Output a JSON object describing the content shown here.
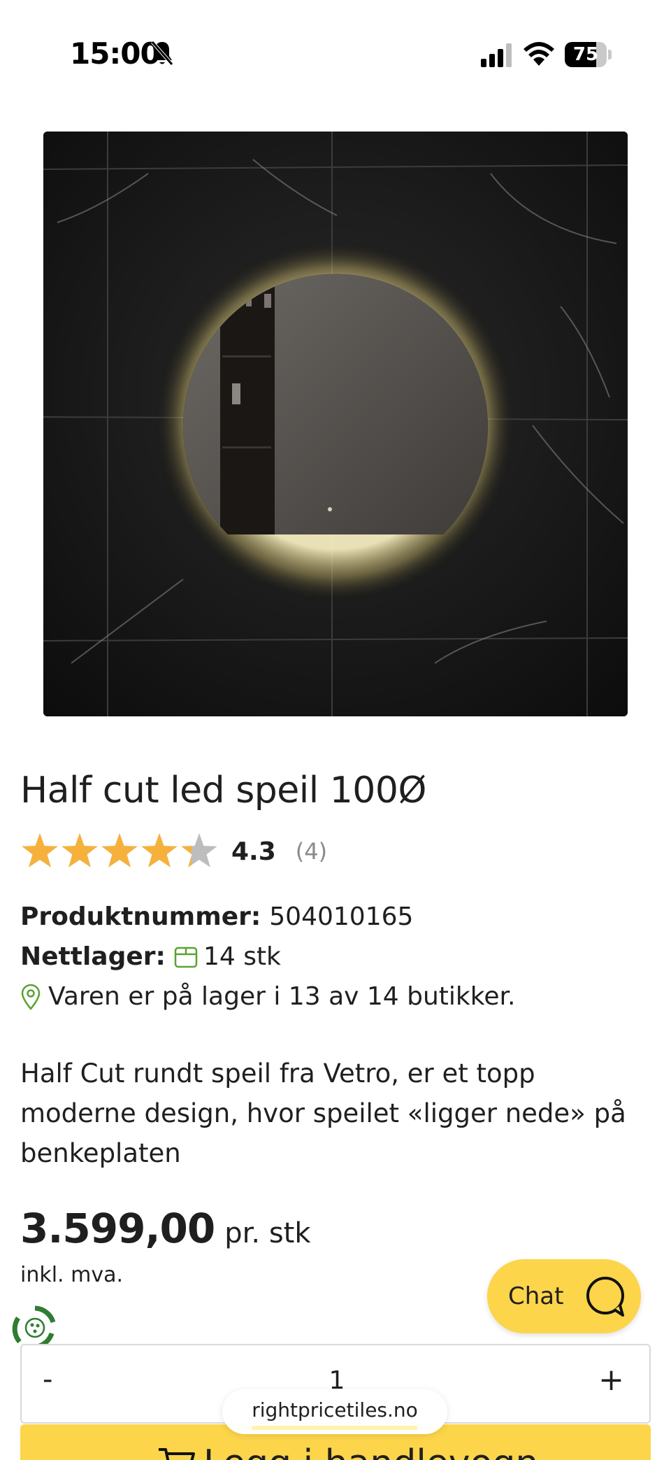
{
  "status_bar": {
    "time": "15:00",
    "battery_level": 75,
    "battery_label": "75",
    "icons": [
      "bell-muted-icon",
      "cellular-signal-icon",
      "wifi-icon",
      "battery-icon"
    ]
  },
  "product": {
    "image_icon": "round-led-mirror-photo",
    "title": "Half cut led speil 100Ø",
    "rating": {
      "value": 4.3,
      "value_label": "4.3",
      "max": 5,
      "count_label": "(4)",
      "star_color": "#f6b13c",
      "empty_star_color": "#bdbdbd"
    },
    "details": {
      "product_number_label": "Produktnummer:",
      "product_number": "504010165",
      "stock_label": "Nettlager:",
      "stock_value": "14 stk",
      "stores_text": "Varen er på lager i 13 av 14 butikker."
    },
    "description": "Half Cut rundt speil fra Vetro, er et topp moderne design, hvor speilet «ligger nede» på benkeplaten",
    "price": {
      "value": "3.599,00",
      "unit": "pr. stk",
      "vat_note": "inkl. mva."
    }
  },
  "chat": {
    "label": "Chat",
    "color": "#fcd54a"
  },
  "quantity": {
    "minus": "-",
    "value": "1",
    "plus": "+"
  },
  "cart": {
    "label": "Legg i handlevogn",
    "color": "#fcd54a"
  },
  "browser": {
    "url": "rightpricetiles.no"
  },
  "colors": {
    "accent_green": "#5aa332",
    "accent_yellow": "#fcd54a"
  }
}
